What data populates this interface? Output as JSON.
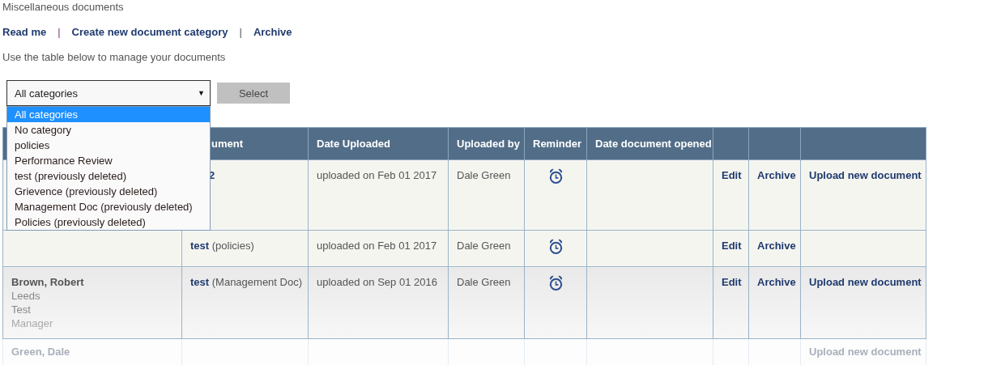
{
  "page_title": "Miscellaneous documents",
  "links": [
    {
      "label": "Read me",
      "separator": "|"
    },
    {
      "label": "Create new document category",
      "separator": "|"
    },
    {
      "label": "Archive"
    }
  ],
  "intro": "Use the table below to manage your documents",
  "category_select": {
    "value": "All categories",
    "caret": "▼",
    "button": "Select",
    "expanded": true,
    "options": [
      {
        "label": "All categories",
        "selected": true
      },
      {
        "label": "No category",
        "selected": false
      },
      {
        "label": "policies",
        "selected": false
      },
      {
        "label": "Performance Review",
        "selected": false
      },
      {
        "label": "test (previously deleted)",
        "selected": false
      },
      {
        "label": "Grievence (previously deleted)",
        "selected": false
      },
      {
        "label": "Management Doc (previously deleted)",
        "selected": false
      },
      {
        "label": "Policies (previously deleted)",
        "selected": false
      }
    ]
  },
  "table": {
    "columns": [
      "ument",
      "Date Uploaded",
      "Uploaded by",
      "Reminder",
      "Date document opened"
    ],
    "rows": [
      {
        "document": {
          "title": "2"
        },
        "date": "uploaded on Feb 01 2017",
        "uploaded_by": "Dale Green",
        "reminder": true,
        "edit": "Edit",
        "archive": "Archive",
        "upload": "Upload new document",
        "faded": false
      },
      {
        "document": {
          "title": "test",
          "category": "(policies)"
        },
        "date": "uploaded on Feb 01 2017",
        "uploaded_by": "Dale Green",
        "reminder": true,
        "edit": "Edit",
        "archive": "Archive",
        "faded": false
      },
      {
        "employee": [
          "Brown, Robert",
          "Leeds",
          "Test",
          "Manager"
        ],
        "document": {
          "title": "test",
          "category": "(Management Doc)"
        },
        "date": "uploaded on Sep 01 2016",
        "uploaded_by": "Dale Green",
        "reminder": true,
        "edit": "Edit",
        "archive": "Archive",
        "upload": "Upload new document",
        "faded": false
      },
      {
        "employee": [
          "Green, Dale"
        ],
        "reminder": false,
        "upload": "Upload new document",
        "faded": true
      }
    ]
  }
}
